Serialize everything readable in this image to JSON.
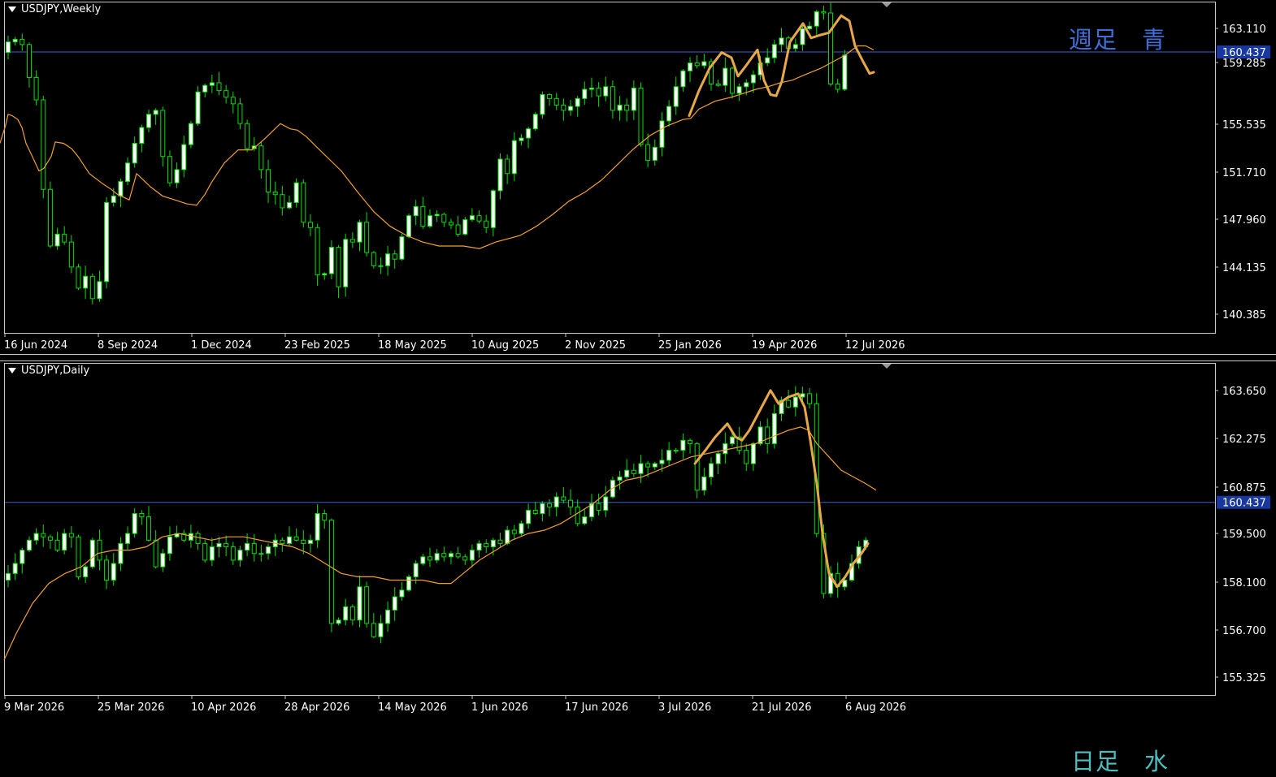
{
  "panes": [
    {
      "id": "weekly",
      "symbol_label": "USDJPY,Weekly",
      "annotation": "週足　青",
      "price_line": "160.437",
      "y_ticks": [
        "163.110",
        "159.285",
        "155.535",
        "151.710",
        "147.960",
        "144.135",
        "140.385"
      ],
      "x_ticks": [
        "16 Jun 2024",
        "8 Sep 2024",
        "1 Dec 2024",
        "23 Feb 2025",
        "18 May 2025",
        "10 Aug 2025",
        "2 Nov 2025",
        "25 Jan 2026",
        "19 Apr 2026",
        "12 Jul 2026"
      ]
    },
    {
      "id": "daily",
      "symbol_label": "USDJPY,Daily",
      "annotation": "日足　水",
      "price_line": "160.437",
      "y_ticks": [
        "163.650",
        "162.275",
        "160.875",
        "159.500",
        "158.100",
        "156.700",
        "155.325"
      ],
      "x_ticks": [
        "9 Mar 2026",
        "25 Mar 2026",
        "10 Apr 2026",
        "28 Apr 2026",
        "14 May 2026",
        "1 Jun 2026",
        "17 Jun 2026",
        "3 Jul 2026",
        "21 Jul 2026",
        "6 Aug 2026"
      ]
    }
  ],
  "colors": {
    "background": "#000000",
    "bull_candle": "#ffffff",
    "bear_candle": "#000000",
    "wick": "#00e000",
    "moving_average": "#f0a030",
    "hand_drawn_line": "#e8a848",
    "price_line": "#4060d0",
    "price_tag_bg": "#1838a0",
    "axis": "#c8c8c8"
  },
  "chart_data": [
    {
      "type": "candlestick",
      "title": "USDJPY,Weekly",
      "y_ticks": [
        163.11,
        159.285,
        155.535,
        151.71,
        147.96,
        144.135,
        140.385
      ],
      "ylim": [
        139.1,
        164.2
      ],
      "horizontal_line": 160.437,
      "x_labels": [
        "16 Jun 2024",
        "8 Sep 2024",
        "1 Dec 2024",
        "23 Feb 2025",
        "18 May 2025",
        "10 Aug 2025",
        "2 Nov 2025",
        "25 Jan 2026",
        "19 Apr 2026",
        "12 Jul 2026"
      ],
      "close_path": [
        160.4,
        161.2,
        161.4,
        161.0,
        158.5,
        156.8,
        150.0,
        145.7,
        146.6,
        146.0,
        144.1,
        142.5,
        143.4,
        141.7,
        143.0,
        149.0,
        149.5,
        150.6,
        152.0,
        153.5,
        154.7,
        155.7,
        156.0,
        152.5,
        150.5,
        151.5,
        153.4,
        155.0,
        157.4,
        157.9,
        158.1,
        157.5,
        157.0,
        156.5,
        155.0,
        153.1,
        153.3,
        151.5,
        149.8,
        149.6,
        148.6,
        149.0,
        150.5,
        147.5,
        147.1,
        143.5,
        143.6,
        145.6,
        142.6,
        146.2,
        146.0,
        147.5,
        145.2,
        144.2,
        144.2,
        145.1,
        144.7,
        146.4,
        148.0,
        148.7,
        147.2,
        148.0,
        148.1,
        147.5,
        147.3,
        146.6,
        147.7,
        148.0,
        147.6,
        147.1,
        149.9,
        152.3,
        151.2,
        153.7,
        153.9,
        154.6,
        155.7,
        157.2,
        156.9,
        156.4,
        156.0,
        156.3,
        156.9,
        157.6,
        157.7,
        157.1,
        157.8,
        156.0,
        156.4,
        156.0,
        157.7,
        153.4,
        152.2,
        153.2,
        155.2,
        156.3,
        157.8,
        159.0,
        159.6,
        159.4,
        159.7,
        158.0,
        157.9,
        159.2,
        157.3,
        157.8,
        158.1,
        158.7,
        159.6,
        160.0,
        161.0,
        161.5,
        160.7,
        161.0,
        162.2,
        162.4,
        163.5,
        163.4,
        158.0,
        157.6,
        160.2
      ],
      "moving_average": [
        [
          0,
          153.5
        ],
        [
          7,
          154.9
        ],
        [
          10,
          155.7
        ],
        [
          15,
          155.6
        ],
        [
          22,
          155.3
        ],
        [
          27,
          154.7
        ],
        [
          32,
          153.5
        ],
        [
          39,
          152.6
        ],
        [
          48,
          151.4
        ],
        [
          54,
          151.6
        ],
        [
          63,
          152.5
        ],
        [
          68,
          153.6
        ],
        [
          78,
          153.5
        ],
        [
          88,
          153.1
        ],
        [
          96,
          152.5
        ],
        [
          110,
          151.2
        ],
        [
          127,
          150.4
        ],
        [
          137,
          150.0
        ],
        [
          145,
          149.6
        ],
        [
          159,
          149.2
        ],
        [
          168,
          151.2
        ],
        [
          175,
          150.8
        ],
        [
          185,
          150.2
        ],
        [
          200,
          149.5
        ],
        [
          215,
          149.2
        ],
        [
          230,
          148.9
        ],
        [
          242,
          148.8
        ],
        [
          252,
          149.6
        ],
        [
          260,
          150.5
        ],
        [
          276,
          152.0
        ],
        [
          293,
          153.0
        ],
        [
          310,
          153.0
        ],
        [
          325,
          153.8
        ],
        [
          335,
          154.4
        ],
        [
          345,
          155.0
        ],
        [
          357,
          154.6
        ],
        [
          366,
          154.5
        ],
        [
          377,
          154.0
        ],
        [
          390,
          153.2
        ],
        [
          405,
          152.3
        ],
        [
          420,
          151.4
        ],
        [
          440,
          149.8
        ],
        [
          460,
          148.3
        ],
        [
          480,
          147.2
        ],
        [
          500,
          146.5
        ],
        [
          520,
          146.0
        ],
        [
          540,
          145.7
        ],
        [
          570,
          145.7
        ],
        [
          590,
          145.5
        ],
        [
          610,
          146.0
        ],
        [
          640,
          146.5
        ],
        [
          660,
          147.2
        ],
        [
          680,
          148.1
        ],
        [
          700,
          149.1
        ],
        [
          720,
          149.8
        ],
        [
          740,
          150.7
        ],
        [
          760,
          151.9
        ],
        [
          780,
          153.1
        ],
        [
          800,
          154.1
        ],
        [
          820,
          154.8
        ],
        [
          840,
          155.3
        ],
        [
          850,
          155.4
        ],
        [
          860,
          156.1
        ],
        [
          880,
          156.7
        ],
        [
          900,
          157.0
        ],
        [
          915,
          157.3
        ],
        [
          930,
          157.6
        ],
        [
          945,
          157.8
        ],
        [
          960,
          158.1
        ],
        [
          975,
          158.3
        ],
        [
          990,
          158.7
        ],
        [
          1010,
          159.2
        ],
        [
          1025,
          159.7
        ],
        [
          1040,
          160.2
        ],
        [
          1055,
          160.9
        ],
        [
          1065,
          160.9
        ],
        [
          1075,
          160.6
        ]
      ],
      "hand_drawn_line": [
        [
          848,
          155.6
        ],
        [
          860,
          157.5
        ],
        [
          873,
          159.2
        ],
        [
          888,
          160.4
        ],
        [
          900,
          160.0
        ],
        [
          908,
          158.6
        ],
        [
          918,
          159.4
        ],
        [
          932,
          160.6
        ],
        [
          940,
          158.3
        ],
        [
          948,
          157.2
        ],
        [
          955,
          157.1
        ],
        [
          962,
          158.2
        ],
        [
          972,
          161.2
        ],
        [
          988,
          162.6
        ],
        [
          998,
          161.5
        ],
        [
          1008,
          161.7
        ],
        [
          1020,
          161.9
        ],
        [
          1035,
          163.2
        ],
        [
          1045,
          162.8
        ],
        [
          1052,
          160.9
        ],
        [
          1062,
          159.7
        ],
        [
          1070,
          158.8
        ],
        [
          1075,
          158.9
        ]
      ]
    },
    {
      "type": "candlestick",
      "title": "USDJPY,Daily",
      "y_ticks": [
        163.65,
        162.275,
        160.875,
        159.5,
        158.1,
        156.7,
        155.325
      ],
      "ylim": [
        154.65,
        164.6
      ],
      "horizontal_line": 160.437,
      "x_labels": [
        "9 Mar 2026",
        "25 Mar 2026",
        "10 Apr 2026",
        "28 Apr 2026",
        "14 May 2026",
        "1 Jun 2026",
        "17 Jun 2026",
        "3 Jul 2026",
        "21 Jul 2026",
        "6 Aug 2026"
      ],
      "close_path": [
        158.1,
        158.3,
        158.6,
        159.0,
        159.3,
        159.5,
        159.4,
        159.3,
        159.0,
        159.5,
        159.4,
        158.2,
        158.5,
        159.3,
        158.7,
        158.1,
        158.6,
        159.2,
        159.5,
        160.1,
        160.0,
        159.3,
        158.5,
        158.9,
        159.4,
        159.5,
        159.3,
        159.5,
        159.2,
        158.7,
        159.1,
        159.2,
        159.1,
        158.7,
        159.0,
        159.2,
        158.9,
        158.9,
        159.1,
        159.3,
        159.2,
        159.4,
        159.3,
        159.2,
        159.3,
        160.1,
        159.9,
        156.8,
        156.9,
        157.3,
        156.9,
        157.9,
        156.8,
        156.4,
        156.8,
        157.2,
        157.6,
        157.8,
        158.2,
        158.6,
        158.8,
        158.7,
        158.9,
        158.8,
        158.9,
        158.8,
        158.7,
        159.0,
        159.2,
        159.1,
        159.3,
        159.2,
        159.6,
        159.5,
        159.8,
        160.2,
        160.1,
        160.4,
        160.3,
        160.6,
        160.5,
        160.3,
        159.8,
        160.0,
        160.4,
        160.2,
        160.6,
        161.1,
        161.2,
        161.4,
        161.3,
        161.6,
        161.5,
        161.6,
        161.7,
        162.0,
        162.0,
        162.3,
        162.2,
        160.8,
        161.2,
        161.6,
        161.9,
        162.2,
        162.4,
        162.0,
        161.6,
        162.2,
        162.7,
        162.2,
        163.1,
        163.5,
        163.3,
        163.6,
        163.7,
        163.4,
        159.5,
        157.7,
        158.3,
        157.9,
        158.1,
        158.6,
        159.1,
        159.3
      ],
      "moving_average": [
        [
          5,
          155.7
        ],
        [
          20,
          156.5
        ],
        [
          40,
          157.4
        ],
        [
          60,
          158.0
        ],
        [
          80,
          158.3
        ],
        [
          100,
          158.5
        ],
        [
          120,
          158.9
        ],
        [
          140,
          159.0
        ],
        [
          160,
          159.0
        ],
        [
          180,
          159.1
        ],
        [
          200,
          159.4
        ],
        [
          220,
          159.5
        ],
        [
          240,
          159.4
        ],
        [
          260,
          159.3
        ],
        [
          280,
          159.4
        ],
        [
          300,
          159.4
        ],
        [
          320,
          159.3
        ],
        [
          340,
          159.2
        ],
        [
          360,
          159.1
        ],
        [
          380,
          158.9
        ],
        [
          400,
          158.6
        ],
        [
          420,
          158.3
        ],
        [
          440,
          158.2
        ],
        [
          460,
          158.2
        ],
        [
          480,
          158.1
        ],
        [
          500,
          158.1
        ],
        [
          520,
          158.1
        ],
        [
          540,
          158.0
        ],
        [
          555,
          158.0
        ],
        [
          570,
          158.3
        ],
        [
          590,
          158.7
        ],
        [
          610,
          159.0
        ],
        [
          630,
          159.3
        ],
        [
          650,
          159.5
        ],
        [
          670,
          159.6
        ],
        [
          690,
          159.8
        ],
        [
          710,
          160.1
        ],
        [
          730,
          160.4
        ],
        [
          750,
          160.8
        ],
        [
          770,
          161.1
        ],
        [
          790,
          161.2
        ],
        [
          810,
          161.4
        ],
        [
          830,
          161.6
        ],
        [
          850,
          161.8
        ],
        [
          870,
          161.9
        ],
        [
          890,
          162.0
        ],
        [
          910,
          162.1
        ],
        [
          930,
          162.2
        ],
        [
          950,
          162.4
        ],
        [
          970,
          162.6
        ],
        [
          985,
          162.7
        ],
        [
          995,
          162.6
        ],
        [
          1005,
          162.2
        ],
        [
          1020,
          161.8
        ],
        [
          1035,
          161.4
        ],
        [
          1050,
          161.2
        ],
        [
          1065,
          161.0
        ],
        [
          1078,
          160.8
        ]
      ],
      "hand_drawn_line": [
        [
          855,
          161.6
        ],
        [
          868,
          162.0
        ],
        [
          880,
          162.4
        ],
        [
          895,
          162.8
        ],
        [
          905,
          162.4
        ],
        [
          913,
          162.3
        ],
        [
          922,
          162.6
        ],
        [
          935,
          163.2
        ],
        [
          948,
          163.8
        ],
        [
          958,
          163.4
        ],
        [
          970,
          163.6
        ],
        [
          982,
          163.7
        ],
        [
          990,
          163.3
        ],
        [
          997,
          162.3
        ],
        [
          1005,
          161.0
        ],
        [
          1012,
          159.5
        ],
        [
          1020,
          158.3
        ],
        [
          1030,
          157.9
        ],
        [
          1040,
          158.2
        ],
        [
          1050,
          158.6
        ],
        [
          1060,
          158.9
        ],
        [
          1068,
          159.2
        ]
      ]
    }
  ]
}
